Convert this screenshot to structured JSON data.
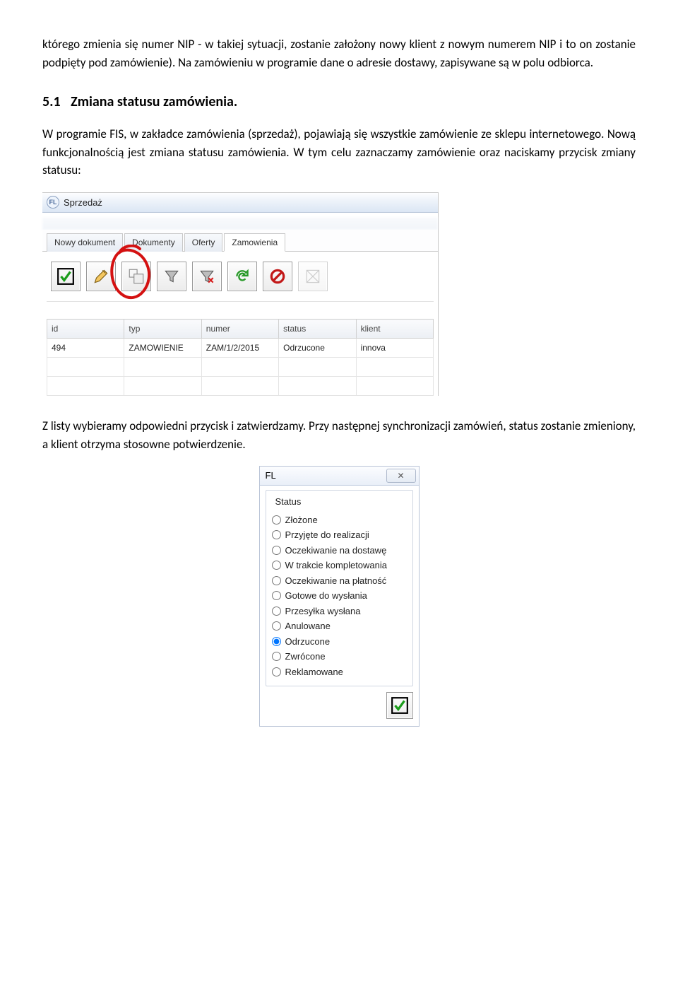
{
  "para1": "którego zmienia się numer NIP - w takiej sytuacji, zostanie założony nowy klient z nowym numerem NIP i to on zostanie podpięty pod zamówienie). Na zamówieniu w programie dane o adresie dostawy, zapisywane są w polu odbiorca.",
  "heading": {
    "num": "5.1",
    "title": "Zmiana statusu zamówienia."
  },
  "para2": "W programie FIS, w zakładce zamówienia (sprzedaż), pojawiają się wszystkie zamówienie ze sklepu internetowego. Nową funkcjonalnością jest zmiana statusu zamówienia. W tym celu zaznaczamy zamówienie oraz naciskamy przycisk zmiany statusu:",
  "para3": "Z listy wybieramy odpowiedni przycisk i zatwierdzamy. Przy następnej synchronizacji zamówień, status zostanie zmieniony, a klient otrzyma stosowne potwierdzenie.",
  "window1": {
    "badge": "FL",
    "title": "Sprzedaż",
    "tabs": [
      "Nowy dokument",
      "Dokumenty",
      "Oferty",
      "Zamowienia"
    ],
    "active_tab_index": 3,
    "toolbar_icons": [
      "confirm-icon",
      "edit-icon",
      "status-change-icon",
      "filter-icon",
      "filter-clear-icon",
      "refresh-icon",
      "cancel-icon",
      "expand-icon"
    ],
    "columns": [
      "id",
      "typ",
      "numer",
      "status",
      "klient"
    ],
    "row": {
      "id": "494",
      "typ": "ZAMOWIENIE",
      "numer": "ZAM/1/2/2015",
      "status": "Odrzucone",
      "klient": "innova"
    }
  },
  "dialog": {
    "badge": "FL",
    "close": "✕",
    "group_title": "Status",
    "options": [
      "Złożone",
      "Przyjęte do realizacji",
      "Oczekiwanie na dostawę",
      "W trakcie kompletowania",
      "Oczekiwanie na płatność",
      "Gotowe do wysłania",
      "Przesyłka wysłana",
      "Anulowane",
      "Odrzucone",
      "Zwrócone",
      "Reklamowane"
    ],
    "selected_index": 8
  }
}
